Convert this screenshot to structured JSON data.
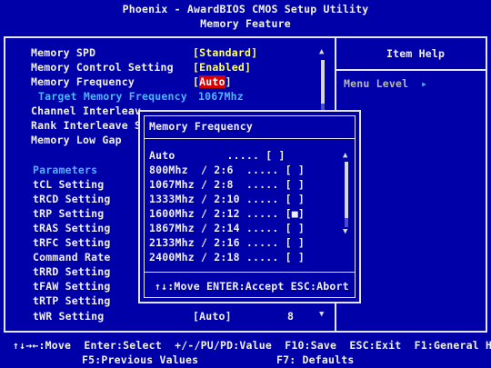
{
  "header": {
    "title": "Phoenix - AwardBIOS CMOS Setup Utility",
    "subtitle": "Memory Feature"
  },
  "help": {
    "title": "Item Help",
    "menu_level": "Menu Level",
    "menu_level_arrow": "▸"
  },
  "settings": [
    {
      "label": "Memory SPD",
      "value": "[Standard]"
    },
    {
      "label": "Memory Control Setting",
      "value": "[Enabled]"
    },
    {
      "label": "Memory Frequency",
      "value_open": "[",
      "value_sel": "Auto",
      "value_close": "]"
    },
    {
      "label": "Target Memory Frequency",
      "value": "1067Mhz"
    },
    {
      "label": "Channel Interleav"
    },
    {
      "label": "Rank Interleave S"
    },
    {
      "label": "Memory Low Gap"
    }
  ],
  "parameters": {
    "heading": "Parameters",
    "items": [
      "tCL Setting",
      "tRCD Setting",
      "tRP Setting",
      "tRAS Setting",
      "tRFC Setting",
      "Command Rate",
      "tRRD Setting",
      "tFAW Setting",
      "tRTP Setting",
      "tWR Setting"
    ],
    "last_value": "[Auto]",
    "last_number": "8"
  },
  "popup": {
    "title": "Memory Frequency",
    "options": [
      "Auto        ..... [ ]",
      "800Mhz  / 2:6  ..... [ ]",
      "1067Mhz / 2:8  ..... [ ]",
      "1333Mhz / 2:10 ..... [ ]",
      "1600Mhz / 2:12 ..... [■]",
      "1867Mhz / 2:14 ..... [ ]",
      "2133Mhz / 2:16 ..... [ ]",
      "2400Mhz / 2:18 ..... [ ]"
    ],
    "hint": "↑↓:Move ENTER:Accept ESC:Abort"
  },
  "footer": {
    "line1": "↑↓→←:Move  Enter:Select  +/-/PU/PD:Value  F10:Save  ESC:Exit  F1:General Help",
    "line2_left": "F5:Previous Values",
    "line2_right": "F7: Defaults"
  },
  "colors": {
    "background": "#0000a8",
    "highlight": "#d60000",
    "value": "#ffff6e",
    "subtle": "#4fb4ff"
  }
}
